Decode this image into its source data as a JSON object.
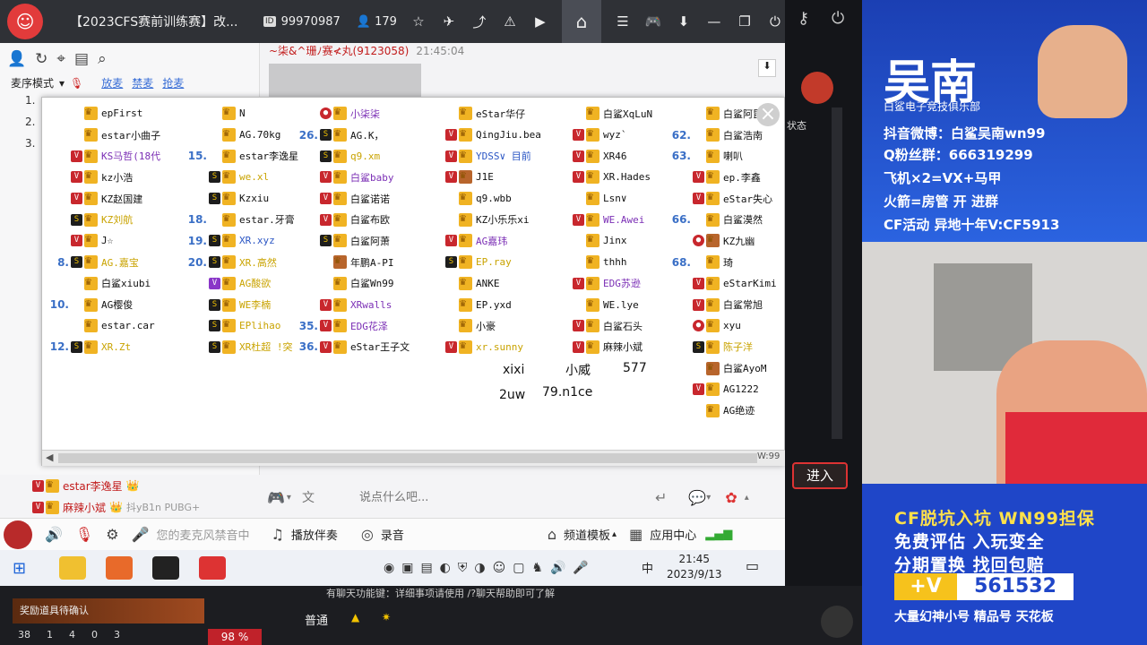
{
  "topbar": {
    "room_title": "【2023CFS赛前训练赛】改...",
    "room_id_tag": "ID",
    "room_id": "99970987",
    "viewers": "179"
  },
  "left": {
    "mode_label": "麦序模式",
    "links": [
      "放麦",
      "禁麦",
      "抢麦"
    ],
    "row_nums": [
      "1.",
      "2.",
      "3."
    ]
  },
  "chat": {
    "user": "~柒&^珊ﾉ赛≮丸(9123058)",
    "time": "21:45:04",
    "placeholder": "说点什么吧...",
    "bottom_msgs": [
      {
        "name": "estar李逸星",
        "suffix": ""
      },
      {
        "name": "麻辣小斌",
        "suffix": "抖yB1n PUBG+"
      }
    ]
  },
  "popup": {
    "columns": [
      [
        {
          "num": "",
          "b": "",
          "name": "epFirst",
          "c": "",
          "k": ""
        },
        {
          "num": "",
          "b": "",
          "name": "estar小曲子",
          "c": "",
          "k": ""
        },
        {
          "num": "",
          "b": "v",
          "name": "KS马哲(18代",
          "c": "purple",
          "k": "p"
        },
        {
          "num": "",
          "b": "v",
          "name": "kz小浩",
          "c": "",
          "k": ""
        },
        {
          "num": "",
          "b": "v",
          "name": "KZ赵国建",
          "c": "",
          "k": ""
        },
        {
          "num": "",
          "b": "s",
          "name": "KZ刘航",
          "c": "dim",
          "k": ""
        },
        {
          "num": "",
          "b": "v",
          "name": "J☆",
          "c": "",
          "k": ""
        },
        {
          "num": "8.",
          "b": "s",
          "name": "AG.嘉宝",
          "c": "dim",
          "k": ""
        },
        {
          "num": "",
          "b": "",
          "name": "白鲨xiubi",
          "c": "",
          "k": ""
        },
        {
          "num": "10.",
          "b": "",
          "name": "AG樱俊",
          "c": "",
          "k": ""
        },
        {
          "num": "",
          "b": "",
          "name": "estar.car",
          "c": "",
          "k": ""
        },
        {
          "num": "12.",
          "b": "s",
          "name": "XR.Zt",
          "c": "dim",
          "k": ""
        }
      ],
      [
        {
          "num": "",
          "b": "",
          "name": "N",
          "c": "",
          "k": ""
        },
        {
          "num": "",
          "b": "",
          "name": "AG.70kg",
          "c": "",
          "k": ""
        },
        {
          "num": "15.",
          "b": "",
          "name": "estar李逸星",
          "c": "",
          "k": ""
        },
        {
          "num": "",
          "b": "s",
          "name": "we.xl",
          "c": "dim",
          "k": ""
        },
        {
          "num": "",
          "b": "s",
          "name": "Kzxiu",
          "c": "",
          "k": ""
        },
        {
          "num": "18.",
          "b": "",
          "name": "estar.牙膏",
          "c": "",
          "k": ""
        },
        {
          "num": "19.",
          "b": "s",
          "name": "XR.xyz",
          "c": "blue",
          "k": ""
        },
        {
          "num": "20.",
          "b": "s",
          "name": "XR.高然",
          "c": "dim",
          "k": ""
        },
        {
          "num": "",
          "b": "p",
          "name": "AG酸欲",
          "c": "dim",
          "k": ""
        },
        {
          "num": "",
          "b": "s",
          "name": "WE李楠",
          "c": "dim",
          "k": ""
        },
        {
          "num": "",
          "b": "s",
          "name": "EPlihao",
          "c": "dim",
          "k": ""
        },
        {
          "num": "",
          "b": "s",
          "name": "XR杜超 !突",
          "c": "dim",
          "k": ""
        }
      ],
      [
        {
          "num": "",
          "b": "r",
          "name": "小柒柒",
          "c": "purple",
          "k": ""
        },
        {
          "num": "26.",
          "b": "s",
          "name": "AG.K，",
          "c": "",
          "k": ""
        },
        {
          "num": "",
          "b": "s",
          "name": "q9.xm",
          "c": "dim",
          "k": ""
        },
        {
          "num": "",
          "b": "v",
          "name": "白鲨baby",
          "c": "purple",
          "k": ""
        },
        {
          "num": "",
          "b": "v",
          "name": "白鲨诺诺",
          "c": "",
          "k": ""
        },
        {
          "num": "",
          "b": "v",
          "name": "白鲨布欧",
          "c": "",
          "k": ""
        },
        {
          "num": "",
          "b": "s",
          "name": "白鲨阿萧",
          "c": "",
          "k": ""
        },
        {
          "num": "",
          "b": "",
          "name": "年鹏A-PI",
          "c": "",
          "k": "brown"
        },
        {
          "num": "",
          "b": "",
          "name": "白鲨Wn99",
          "c": "",
          "k": ""
        },
        {
          "num": "",
          "b": "v",
          "name": "XRwalls",
          "c": "purple",
          "k": ""
        },
        {
          "num": "35.",
          "b": "v",
          "name": "EDG花泽",
          "c": "purple",
          "k": ""
        },
        {
          "num": "36.",
          "b": "v",
          "name": "eStar王子文",
          "c": "",
          "k": ""
        }
      ],
      [
        {
          "num": "",
          "b": "",
          "name": "eStar华仔",
          "c": "",
          "k": ""
        },
        {
          "num": "",
          "b": "v",
          "name": "QingJiu.bea",
          "c": "",
          "k": ""
        },
        {
          "num": "",
          "b": "v",
          "name": "YDSS∨ 目前",
          "c": "blue",
          "k": ""
        },
        {
          "num": "",
          "b": "v",
          "name": "J1E",
          "c": "",
          "k": "brown"
        },
        {
          "num": "",
          "b": "",
          "name": "q9.wbb",
          "c": "",
          "k": ""
        },
        {
          "num": "",
          "b": "",
          "name": "KZ小乐乐xi",
          "c": "",
          "k": ""
        },
        {
          "num": "",
          "b": "v",
          "name": "AG嘉玮",
          "c": "purple",
          "k": ""
        },
        {
          "num": "",
          "b": "s",
          "name": "EP.ray",
          "c": "dim",
          "k": ""
        },
        {
          "num": "",
          "b": "",
          "name": "ANKE",
          "c": "",
          "k": ""
        },
        {
          "num": "",
          "b": "",
          "name": "EP.yxd",
          "c": "",
          "k": ""
        },
        {
          "num": "",
          "b": "",
          "name": "小豪",
          "c": "",
          "k": ""
        },
        {
          "num": "",
          "b": "v",
          "name": "xr.sunny",
          "c": "dim",
          "k": ""
        }
      ],
      [
        {
          "num": "",
          "b": "",
          "name": "白鲨XqLuN",
          "c": "",
          "k": ""
        },
        {
          "num": "",
          "b": "v",
          "name": "wyz`",
          "c": "",
          "k": ""
        },
        {
          "num": "",
          "b": "v",
          "name": "XR46",
          "c": "",
          "k": ""
        },
        {
          "num": "",
          "b": "v",
          "name": "XR.Hades",
          "c": "",
          "k": ""
        },
        {
          "num": "",
          "b": "",
          "name": "Lsn∨",
          "c": "",
          "k": ""
        },
        {
          "num": "",
          "b": "v",
          "name": "WE.Awei",
          "c": "purple",
          "k": ""
        },
        {
          "num": "",
          "b": "",
          "name": "Jinx",
          "c": "",
          "k": ""
        },
        {
          "num": "",
          "b": "",
          "name": "thhh",
          "c": "",
          "k": ""
        },
        {
          "num": "",
          "b": "v",
          "name": "EDG苏逊",
          "c": "purple",
          "k": ""
        },
        {
          "num": "",
          "b": "",
          "name": "WE.lye",
          "c": "",
          "k": ""
        },
        {
          "num": "",
          "b": "v",
          "name": "白鲨石头",
          "c": "",
          "k": ""
        },
        {
          "num": "",
          "b": "v",
          "name": "麻辣小斌",
          "c": "",
          "k": ""
        }
      ],
      [
        {
          "num": "",
          "b": "",
          "name": "白鲨阿昆",
          "c": "",
          "k": ""
        },
        {
          "num": "62.",
          "b": "",
          "name": "白鲨浩南",
          "c": "",
          "k": ""
        },
        {
          "num": "63.",
          "b": "",
          "name": "喇叭",
          "c": "",
          "k": ""
        },
        {
          "num": "",
          "b": "v",
          "name": "ep.李鑫",
          "c": "",
          "k": ""
        },
        {
          "num": "",
          "b": "v",
          "name": "eStar失心",
          "c": "",
          "k": ""
        },
        {
          "num": "66.",
          "b": "",
          "name": "白鲨漠然",
          "c": "",
          "k": ""
        },
        {
          "num": "",
          "b": "r",
          "name": "KZ九幽",
          "c": "",
          "k": "brown"
        },
        {
          "num": "68.",
          "b": "",
          "name": "琦",
          "c": "",
          "k": ""
        },
        {
          "num": "",
          "b": "v",
          "name": "eStarKimi",
          "c": "",
          "k": ""
        },
        {
          "num": "",
          "b": "v",
          "name": "白鲨常旭",
          "c": "",
          "k": ""
        },
        {
          "num": "",
          "b": "r",
          "name": "xyu",
          "c": "",
          "k": ""
        },
        {
          "num": "",
          "b": "s",
          "name": "陈子洋",
          "c": "dim",
          "k": ""
        },
        {
          "num": "",
          "b": "",
          "name": "白鲨AyoM",
          "c": "",
          "k": "brown"
        },
        {
          "num": "",
          "b": "v",
          "name": "AG1222",
          "c": "",
          "k": ""
        },
        {
          "num": "",
          "b": "",
          "name": "AG绝迹",
          "c": "",
          "k": ""
        }
      ]
    ],
    "hand": [
      "xixi",
      "小威",
      "577",
      "2uw",
      "79.n1ce"
    ],
    "corner": "W:99"
  },
  "voice": {
    "mic_status": "您的麦克风禁音中",
    "accomp": "播放伴奏",
    "record": "录音",
    "template": "频道模板",
    "appcenter": "应用中心"
  },
  "taskbar": {
    "ime": "中",
    "time": "21:45",
    "date": "2023/9/13"
  },
  "app_bottom": {
    "notice": "奖励道具待确认",
    "ticker": "有聊天功能键：详细事项请使用 /?聊天帮助即可了解",
    "mode": "普通",
    "stats": [
      "38",
      "1",
      "4",
      "0",
      "3"
    ],
    "pct": "98 %"
  },
  "enter_label": "进入",
  "side_label": "状态",
  "overlay": {
    "name": "吴南",
    "club": "白鲨电子竞技俱乐部",
    "lines": [
      "抖音微博：白鲨吴南wn99",
      "Q粉丝群：666319299",
      "飞机×2=VX+马甲",
      "火箭=房管  开   进群",
      "CF活动 异地十年V:CF5913"
    ],
    "promo": [
      "CF脱坑入坑 WN99担保",
      "免费评估     入玩变全",
      "分期置换     找回包赔"
    ],
    "plus": "+V",
    "qq": "561532",
    "foot": "大量幻神小号 精品号 天花板"
  },
  "colors": {
    "accent": "#3a6fc6",
    "red": "#c8272d",
    "gold": "#f0b323",
    "brand_blue": "#2a4bb8"
  }
}
